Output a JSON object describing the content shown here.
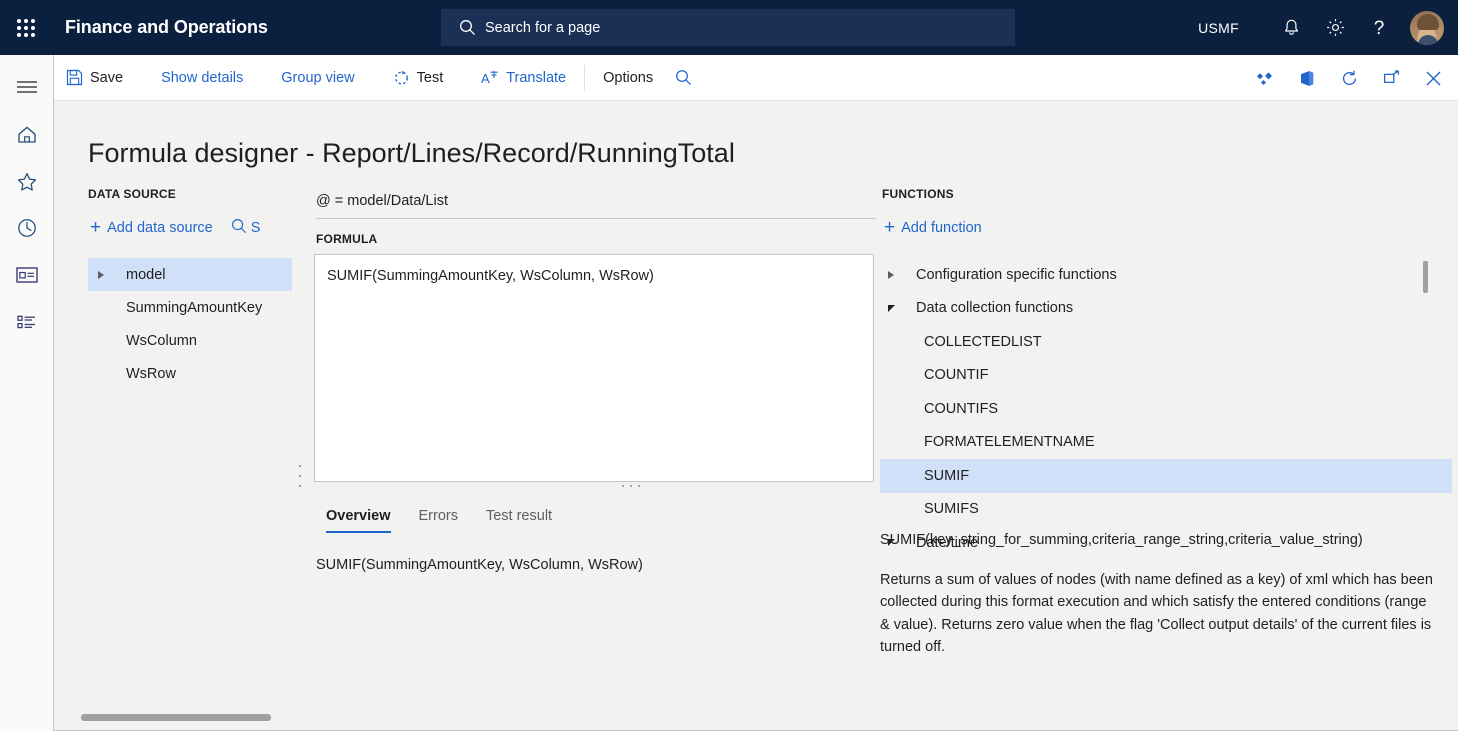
{
  "header": {
    "app_title": "Finance and Operations",
    "waffle_icon": "app-launcher-icon",
    "search_placeholder": "Search for a page",
    "search_value": "",
    "company": "USMF",
    "notifications_icon": "bell-icon",
    "settings_icon": "gear-icon",
    "help_icon": "question-mark-icon",
    "avatar_icon": "user-avatar",
    "bg_color": "#0b1f3f",
    "search_bg_color": "#1b3055"
  },
  "rail": {
    "items": [
      {
        "icon": "hamburger-menu-icon",
        "name": "menu"
      },
      {
        "icon": "home-icon",
        "name": "home"
      },
      {
        "icon": "star-icon",
        "name": "favorites"
      },
      {
        "icon": "clock-icon",
        "name": "recent"
      },
      {
        "icon": "workspace-icon",
        "name": "workspaces"
      },
      {
        "icon": "list-icon",
        "name": "modules"
      }
    ]
  },
  "toolbar": {
    "items": [
      {
        "label": "Save",
        "icon": "save-icon",
        "style": "dark"
      },
      {
        "label": "Show details",
        "icon": "",
        "style": "link"
      },
      {
        "label": "Group view",
        "icon": "",
        "style": "link"
      },
      {
        "label": "Test",
        "icon": "refresh-dotted-icon",
        "style": "dark"
      },
      {
        "label": "Translate",
        "icon": "translate-icon",
        "style": "link"
      }
    ],
    "options_label": "Options",
    "search_icon": "search-icon",
    "right_icons": [
      {
        "icon": "dynamics-diamond-icon",
        "name": "dynamics-365"
      },
      {
        "icon": "office-icon",
        "name": "open-in-office"
      },
      {
        "icon": "refresh-icon",
        "name": "refresh"
      },
      {
        "icon": "popout-icon",
        "name": "open-in-new-window"
      },
      {
        "icon": "close-icon",
        "name": "close"
      }
    ],
    "accent_color": "#2266cc"
  },
  "page": {
    "title": "Formula designer - Report/Lines/Record/RunningTotal"
  },
  "data_source": {
    "section_label": "DATA SOURCE",
    "add_label": "Add data source",
    "search_label": "S",
    "search_icon": "search-icon",
    "tree": [
      {
        "label": "model",
        "expander": "collapsed",
        "indent": 0,
        "selected": true
      },
      {
        "label": "SummingAmountKey",
        "expander": "none",
        "indent": 1,
        "selected": false
      },
      {
        "label": "WsColumn",
        "expander": "none",
        "indent": 1,
        "selected": false
      },
      {
        "label": "WsRow",
        "expander": "none",
        "indent": 1,
        "selected": false
      }
    ]
  },
  "formula": {
    "binding_line": "@ = model/Data/List",
    "section_label": "FORMULA",
    "editor_value": "SUMIF(SummingAmountKey, WsColumn, WsRow)",
    "editor_placeholder": "",
    "tabs": [
      {
        "label": "Overview",
        "active": true
      },
      {
        "label": "Errors",
        "active": false
      },
      {
        "label": "Test result",
        "active": false
      }
    ],
    "overview_text": "SUMIF(SummingAmountKey, WsColumn, WsRow)"
  },
  "functions": {
    "section_label": "FUNCTIONS",
    "add_label": "Add function",
    "tree": [
      {
        "label": "Configuration specific functions",
        "expander": "collapsed",
        "indent": 0,
        "selected": false
      },
      {
        "label": "Data collection functions",
        "expander": "expanded",
        "indent": 0,
        "selected": false
      },
      {
        "label": "COLLECTEDLIST",
        "expander": "none",
        "indent": 1,
        "selected": false
      },
      {
        "label": "COUNTIF",
        "expander": "none",
        "indent": 1,
        "selected": false
      },
      {
        "label": "COUNTIFS",
        "expander": "none",
        "indent": 1,
        "selected": false
      },
      {
        "label": "FORMATELEMENTNAME",
        "expander": "none",
        "indent": 1,
        "selected": false
      },
      {
        "label": "SUMIF",
        "expander": "none",
        "indent": 1,
        "selected": true
      },
      {
        "label": "SUMIFS",
        "expander": "none",
        "indent": 1,
        "selected": false
      },
      {
        "label": "Date/time",
        "expander": "expanded",
        "indent": 0,
        "selected": false
      }
    ],
    "selection_color": "#cfe0f8"
  },
  "description": {
    "signature": "SUMIF(key_string_for_summing,criteria_range_string,criteria_value_string)",
    "body": "Returns a sum of values of nodes (with name defined as a key) of xml which has been collected during this format execution and which satisfy the entered conditions (range & value). Returns zero value when the flag 'Collect output details' of the current files is turned off.",
    "scroll_up_icon": "chevron-up-icon",
    "scroll_down_icon": "chevron-down-icon"
  }
}
